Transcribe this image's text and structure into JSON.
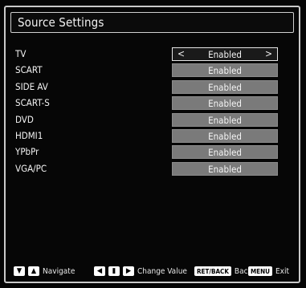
{
  "title": "Source Settings",
  "rows": [
    {
      "label": "TV",
      "value": "Enabled",
      "selected": true
    },
    {
      "label": "SCART",
      "value": "Enabled",
      "selected": false
    },
    {
      "label": "SIDE AV",
      "value": "Enabled",
      "selected": false
    },
    {
      "label": "SCART-S",
      "value": "Enabled",
      "selected": false
    },
    {
      "label": "DVD",
      "value": "Enabled",
      "selected": false
    },
    {
      "label": "HDMI1",
      "value": "Enabled",
      "selected": false
    },
    {
      "label": "YPbPr",
      "value": "Enabled",
      "selected": false
    },
    {
      "label": "VGA/PC",
      "value": "Enabled",
      "selected": false
    }
  ],
  "arrows": {
    "left": "<",
    "right": ">"
  },
  "footer": {
    "navigate": {
      "label": "Navigate",
      "icons": [
        "▼",
        "▲"
      ]
    },
    "change_value": {
      "label": "Change Value",
      "icons": [
        "◀",
        "▮",
        "▶"
      ]
    },
    "back": {
      "label": "Back",
      "key": "RET/BACK"
    },
    "exit": {
      "label": "Exit",
      "key": "MENU"
    }
  },
  "colors": {
    "background": "#050505",
    "border": "#c9c9c9",
    "value_bg": "#7a7a7a",
    "text": "#ffffff"
  }
}
